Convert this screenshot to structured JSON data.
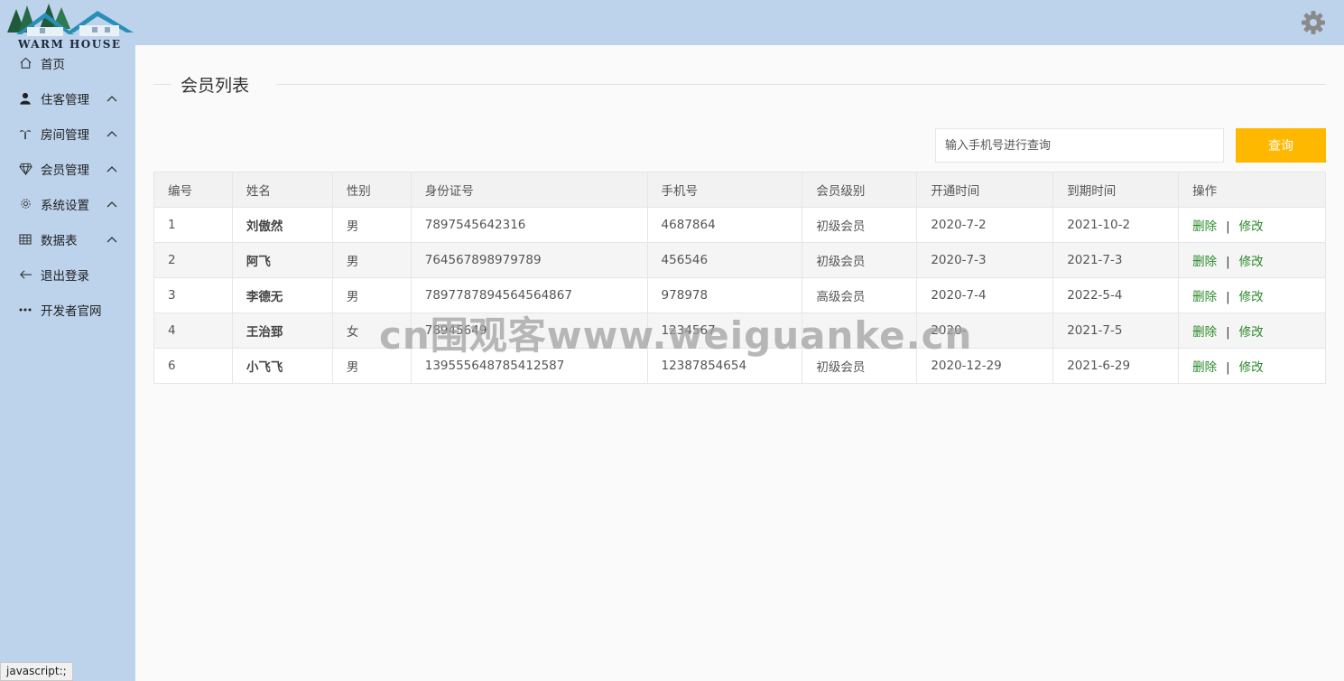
{
  "app": {
    "logo_text": "WARM HOUSE"
  },
  "sidebar": {
    "items": [
      {
        "label": "首页",
        "icon": "home-icon",
        "expandable": false
      },
      {
        "label": "住客管理",
        "icon": "user-icon",
        "expandable": true
      },
      {
        "label": "房间管理",
        "icon": "palm-tree-icon",
        "expandable": true
      },
      {
        "label": "会员管理",
        "icon": "diamond-icon",
        "expandable": true
      },
      {
        "label": "系统设置",
        "icon": "gear-icon",
        "expandable": true
      },
      {
        "label": "数据表",
        "icon": "table-icon",
        "expandable": true
      },
      {
        "label": "退出登录",
        "icon": "arrow-left-icon",
        "expandable": false
      },
      {
        "label": "开发者官网",
        "icon": "ellipsis-icon",
        "expandable": false
      }
    ]
  },
  "header": {
    "settings_icon": "gear-icon"
  },
  "main": {
    "title": "会员列表",
    "search": {
      "placeholder": "输入手机号进行查询",
      "value": "",
      "button_label": "查询"
    },
    "table": {
      "columns": [
        "编号",
        "姓名",
        "性别",
        "身份证号",
        "手机号",
        "会员级别",
        "开通时间",
        "到期时间",
        "操作"
      ],
      "rows": [
        {
          "id": "1",
          "name": "刘傲然",
          "gender": "男",
          "id_card": "7897545642316",
          "phone": "4687864",
          "level": "初级会员",
          "level_type": "basic",
          "start": "2020-7-2",
          "end": "2021-10-2"
        },
        {
          "id": "2",
          "name": "阿飞",
          "gender": "男",
          "id_card": "764567898979789",
          "phone": "456546",
          "level": "初级会员",
          "level_type": "basic",
          "start": "2020-7-3",
          "end": "2021-7-3"
        },
        {
          "id": "3",
          "name": "李德无",
          "gender": "男",
          "id_card": "7897787894564564867",
          "phone": "978978",
          "level": "高级会员",
          "level_type": "high",
          "start": "2020-7-4",
          "end": "2022-5-4"
        },
        {
          "id": "4",
          "name": "王治郅",
          "gender": "女",
          "id_card": "78945649",
          "phone": "1234567",
          "level": "",
          "level_type": "basic",
          "start": "2020-",
          "end": "2021-7-5"
        },
        {
          "id": "6",
          "name": "小飞飞",
          "gender": "男",
          "id_card": "139555648785412587",
          "phone": "12387854654",
          "level": "初级会员",
          "level_type": "basic",
          "start": "2020-12-29",
          "end": "2021-6-29"
        }
      ],
      "actions": {
        "delete": "删除",
        "edit": "修改",
        "separator": "|"
      }
    }
  },
  "watermark": "cn围观客www.weiguanke.cn",
  "statusbar": {
    "text": "javascript:;"
  },
  "colors": {
    "sidebar_bg": "#bdd3ec",
    "accent_button": "#ffb800",
    "level_basic": "#1e3d8f",
    "level_high": "#c0392b",
    "action_link": "#2b8a2b"
  }
}
